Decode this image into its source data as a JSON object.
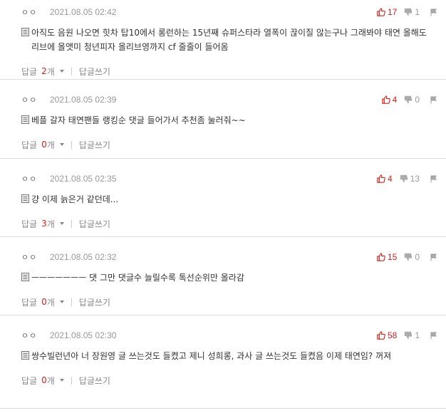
{
  "comments": [
    {
      "author": "ㅇㅇ",
      "date": "2021.08.05 02:42",
      "upvotes": "17",
      "downvotes": "1",
      "text": "아직도 음원 나오면 힛차 탑10에서 롱런하는 15년째 슈퍼스타라 열폭이 끊이질 않는구나 그래봐야 태연 올해도 리브에 올앳미 청년피자 올리브영까지 cf 줄줄이 들어옴",
      "reply_label": "답글",
      "reply_count": "2",
      "reply_unit": "개",
      "write_label": "답글쓰기"
    },
    {
      "author": "ㅇㅇ",
      "date": "2021.08.05 02:39",
      "upvotes": "4",
      "downvotes": "0",
      "text": "베플 갈자 태연팬들 랭킹순 댓글 들어가서 추천좀 눌러줘~~",
      "reply_label": "답글",
      "reply_count": "0",
      "reply_unit": "개",
      "write_label": "답글쓰기"
    },
    {
      "author": "ㅇㅇ",
      "date": "2021.08.05 02:35",
      "upvotes": "4",
      "downvotes": "13",
      "text": "걍 이제 늙은거 같던데...",
      "reply_label": "답글",
      "reply_count": "3",
      "reply_unit": "개",
      "write_label": "답글쓰기"
    },
    {
      "author": "ㅇㅇ",
      "date": "2021.08.05 02:32",
      "upvotes": "15",
      "downvotes": "0",
      "text": "ㅡㅡㅡㅡㅡㅡㅡ 댓 그만 댓글수 늘릴수록 톡선순위만 올라감",
      "reply_label": "답글",
      "reply_count": "0",
      "reply_unit": "개",
      "write_label": "답글쓰기"
    },
    {
      "author": "ㅇㅇ",
      "date": "2021.08.05 02:30",
      "upvotes": "58",
      "downvotes": "1",
      "text": "쌍수빌런년아 너 장원영 글 쓰는것도 들켰고 제니 성희롱, 과사 글 쓰는것도 들켰음 이제 태연임? 꺼져",
      "reply_label": "답글",
      "reply_count": "0",
      "reply_unit": "개",
      "write_label": "답글쓰기"
    }
  ],
  "icons": {
    "upvote": "thumbs-up-icon",
    "downvote": "thumbs-down-icon",
    "report": "report-icon",
    "comment_body": "document-icon",
    "reply_toggle": "caret-down-icon"
  },
  "colors": {
    "upvote": "#d0211c",
    "reply_count": "#d0211c",
    "muted": "#999999",
    "divider": "#dcdcdc"
  }
}
